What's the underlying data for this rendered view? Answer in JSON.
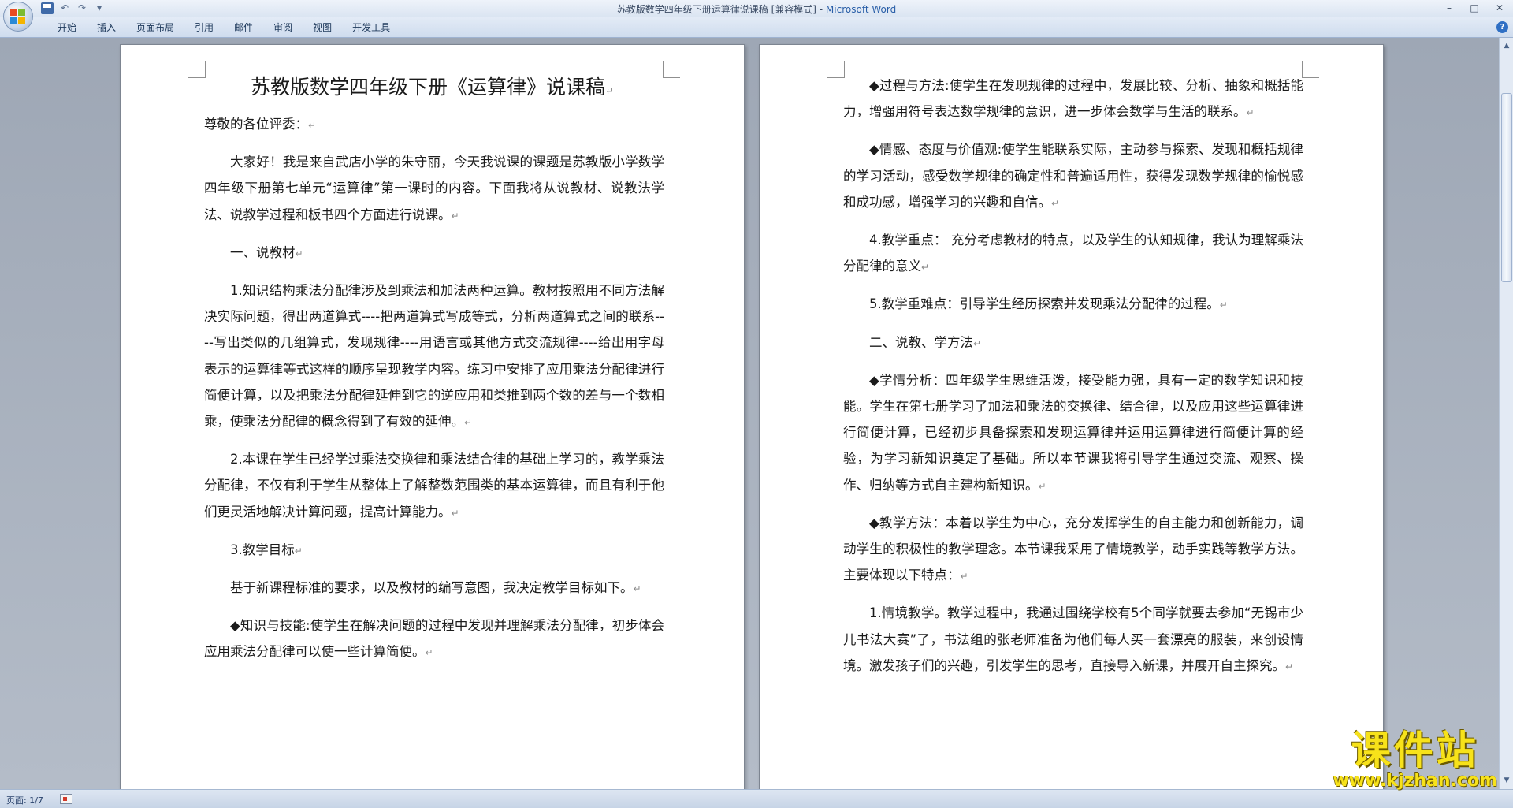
{
  "window": {
    "title": "苏教版数学四年级下册运算律说课稿 [兼容模式] - ",
    "app_name": "Microsoft Word",
    "minimize": "–",
    "maximize": "□",
    "close": "✕"
  },
  "qat": {
    "undo": "↶",
    "redo": "↷",
    "more": "▾"
  },
  "ribbon": {
    "tabs": [
      "开始",
      "插入",
      "页面布局",
      "引用",
      "邮件",
      "审阅",
      "视图",
      "开发工具"
    ],
    "help": "?"
  },
  "page1": {
    "title": "苏教版数学四年级下册《运算律》说课稿",
    "paragraphs": [
      {
        "text": "尊敬的各位评委：",
        "indent": false
      },
      {
        "text": "大家好！我是来自武店小学的朱守丽，今天我说课的课题是苏教版小学数学四年级下册第七单元“运算律”第一课时的内容。下面我将从说教材、说教法学法、说教学过程和板书四个方面进行说课。",
        "indent": true
      },
      {
        "text": "一、说教材",
        "indent": true
      },
      {
        "text": "1.知识结构乘法分配律涉及到乘法和加法两种运算。教材按照用不同方法解决实际问题，得出两道算式----把两道算式写成等式，分析两道算式之间的联系----写出类似的几组算式，发现规律----用语言或其他方式交流规律----给出用字母表示的运算律等式这样的顺序呈现教学内容。练习中安排了应用乘法分配律进行简便计算，以及把乘法分配律延伸到它的逆应用和类推到两个数的差与一个数相乘，使乘法分配律的概念得到了有效的延伸。",
        "indent": true
      },
      {
        "text": "2.本课在学生已经学过乘法交换律和乘法结合律的基础上学习的，教学乘法分配律，不仅有利于学生从整体上了解整数范围类的基本运算律，而且有利于他们更灵活地解决计算问题，提高计算能力。",
        "indent": true
      },
      {
        "text": "3.教学目标",
        "indent": true
      },
      {
        "text": "基于新课程标准的要求，以及教材的编写意图，我决定教学目标如下。",
        "indent": true
      },
      {
        "text": "◆知识与技能:使学生在解决问题的过程中发现并理解乘法分配律，初步体会应用乘法分配律可以使一些计算简便。",
        "indent": true
      }
    ]
  },
  "page2": {
    "paragraphs": [
      {
        "text": "◆过程与方法:使学生在发现规律的过程中，发展比较、分析、抽象和概括能力，增强用符号表达数学规律的意识，进一步体会数学与生活的联系。",
        "indent": true
      },
      {
        "text": "◆情感、态度与价值观:使学生能联系实际，主动参与探索、发现和概括规律的学习活动，感受数学规律的确定性和普遍适用性，获得发现数学规律的愉悦感和成功感，增强学习的兴趣和自信。",
        "indent": true
      },
      {
        "text": "4.教学重点： 充分考虑教材的特点，以及学生的认知规律，我认为理解乘法分配律的意义",
        "indent": true
      },
      {
        "text": "5.教学重难点：引导学生经历探索并发现乘法分配律的过程。",
        "indent": true
      },
      {
        "text": "二、说教、学方法",
        "indent": true
      },
      {
        "text": "◆学情分析：四年级学生思维活泼，接受能力强，具有一定的数学知识和技能。学生在第七册学习了加法和乘法的交换律、结合律，以及应用这些运算律进行简便计算，已经初步具备探索和发现运算律并运用运算律进行简便计算的经验，为学习新知识奠定了基础。所以本节课我将引导学生通过交流、观察、操作、归纳等方式自主建构新知识。",
        "indent": true
      },
      {
        "text": "◆教学方法：本着以学生为中心，充分发挥学生的自主能力和创新能力，调动学生的积极性的教学理念。本节课我采用了情境教学，动手实践等教学方法。主要体现以下特点：",
        "indent": true
      },
      {
        "text": "1.情境教学。教学过程中，我通过围绕学校有5个同学就要去参加“无锡市少儿书法大赛”了，书法组的张老师准备为他们每人买一套漂亮的服装，来创设情境。激发孩子们的兴趣，引发学生的思考，直接导入新课，并展开自主探究。",
        "indent": true
      }
    ]
  },
  "paragraph_mark": "↵",
  "scroll": {
    "up": "▲",
    "down": "▼"
  },
  "status": {
    "page": "页面: 1/7"
  },
  "watermark": {
    "title": "课件站",
    "url": "www.kjzhan.com"
  }
}
